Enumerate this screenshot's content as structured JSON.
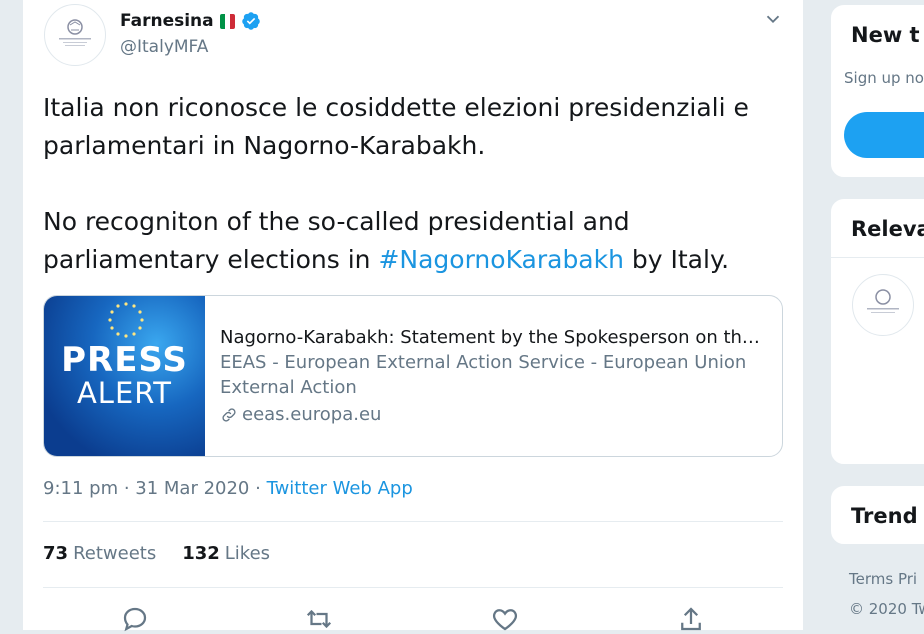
{
  "tweet": {
    "display_name": "Farnesina",
    "handle": "@ItalyMFA",
    "flag_icon": "italy-flag-icon",
    "verified_icon": "verified-badge-icon",
    "text_p1": "Italia non riconosce le cosiddette elezioni presidenziali e parlamentari in Nagorno-Karabakh.",
    "text_p2_before": "No recogniton of the so-called presidential and parliamentary elections in ",
    "hashtag": "#NagornoKarabakh",
    "text_p2_after": " by Italy.",
    "card": {
      "thumb_line1": "PRESS",
      "thumb_line2": "ALERT",
      "title": "Nagorno-Karabakh: Statement by the Spokesperson on the so...",
      "description": "EEAS - European External Action Service - European Union External Action",
      "domain": "eeas.europa.eu"
    },
    "timestamp": "9:11 pm · 31 Mar 2020 · ",
    "source": "Twitter Web App",
    "retweets_count": "73",
    "retweets_label": "Retweets",
    "likes_count": "132",
    "likes_label": "Likes"
  },
  "sidebar": {
    "new_title": "New t",
    "new_sub": "Sign up no",
    "relevant_title": "Releva",
    "trends_title": "Trend",
    "footer_links": "Terms   Pri",
    "footer_copy": "© 2020 Tw"
  },
  "colors": {
    "link": "#1b95e0",
    "accent": "#1da1f2",
    "muted": "#657786",
    "text": "#14171a"
  }
}
